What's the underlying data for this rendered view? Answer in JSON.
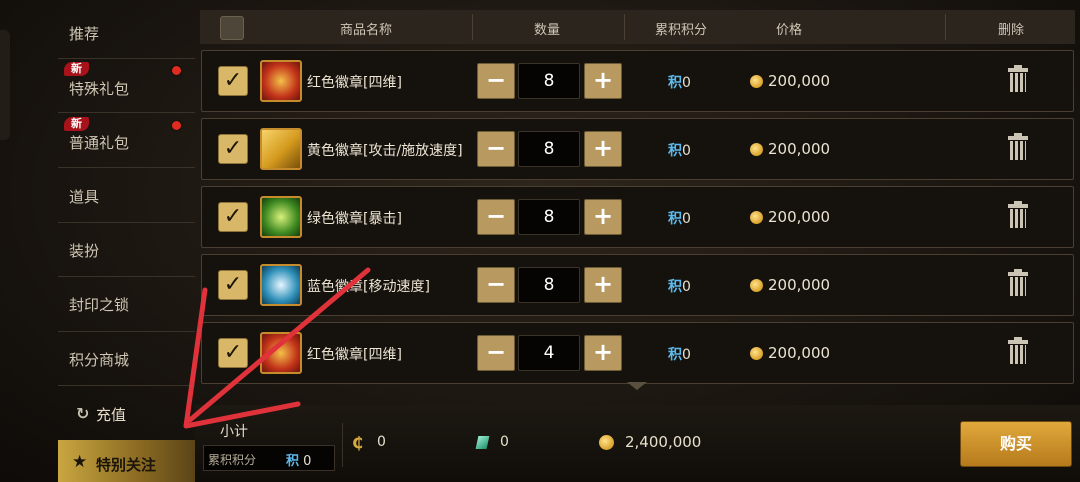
{
  "sidebar": {
    "items": [
      {
        "label": "推荐"
      },
      {
        "label": "特殊礼包",
        "badge": "新"
      },
      {
        "label": "普通礼包",
        "badge": "新"
      },
      {
        "label": "道具"
      },
      {
        "label": "装扮"
      },
      {
        "label": "封印之锁"
      },
      {
        "label": "积分商城"
      },
      {
        "label": "充值"
      },
      {
        "label": "特别关注"
      }
    ]
  },
  "table": {
    "headers": {
      "name": "商品名称",
      "qty": "数量",
      "points": "累积积分",
      "price": "价格",
      "delete": "删除"
    },
    "rows": [
      {
        "name": "红色徽章[四维]",
        "qty": "8",
        "points_prefix": "积",
        "points": "0",
        "price": "200,000",
        "icon_color": "#c2331a"
      },
      {
        "name": "黄色徽章[攻击/施放速度]",
        "qty": "8",
        "points_prefix": "积",
        "points": "0",
        "price": "200,000",
        "icon_color": "#d49a1e"
      },
      {
        "name": "绿色徽章[暴击]",
        "qty": "8",
        "points_prefix": "积",
        "points": "0",
        "price": "200,000",
        "icon_color": "#3f8a22"
      },
      {
        "name": "蓝色徽章[移动速度]",
        "qty": "8",
        "points_prefix": "积",
        "points": "0",
        "price": "200,000",
        "icon_color": "#2e8fb8"
      },
      {
        "name": "红色徽章[四维]",
        "qty": "4",
        "points_prefix": "积",
        "points": "0",
        "price": "200,000",
        "icon_color": "#c2331a"
      }
    ],
    "minus": "−",
    "plus": "+"
  },
  "footer": {
    "total_label": "小计",
    "points_label": "累积积分",
    "points_prefix": "积",
    "points_value": "0",
    "coupon_value": "0",
    "gem_value": "0",
    "gold_value": "2,400,000",
    "buy_label": "购买"
  },
  "colors": {
    "accent_gold": "#d9a12a",
    "annotation_red": "#e0323a",
    "badge_red": "#a8131b"
  }
}
